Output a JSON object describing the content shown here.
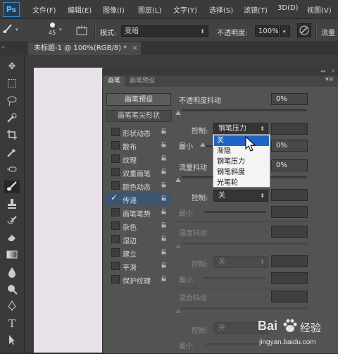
{
  "app": {
    "logo": "Ps"
  },
  "menu": [
    "文件(F)",
    "编辑(E)",
    "图像(I)",
    "图层(L)",
    "文字(Y)",
    "选择(S)",
    "滤镜(T)",
    "3D(D)",
    "视图(V)"
  ],
  "options_bar": {
    "brush_size": "45",
    "mode_label": "模式:",
    "mode_value": "变暗",
    "opacity_label": "不透明度:",
    "opacity_value": "100%",
    "flow_label": "流量"
  },
  "document_tab": {
    "title": "未标题-1 @ 100%(RGB/8) *",
    "close": "×"
  },
  "brush_panel": {
    "tabs": [
      "画笔",
      "画笔预设"
    ],
    "presets_button": "画笔预设",
    "tip_shape": "画笔笔尖形状",
    "options": [
      {
        "label": "形状动态",
        "checked": false,
        "selected": false
      },
      {
        "label": "散布",
        "checked": false,
        "selected": false
      },
      {
        "label": "纹理",
        "checked": false,
        "selected": false
      },
      {
        "label": "双重画笔",
        "checked": false,
        "selected": false
      },
      {
        "label": "颜色动态",
        "checked": false,
        "selected": false
      },
      {
        "label": "传递",
        "checked": true,
        "selected": true
      },
      {
        "label": "画笔笔势",
        "checked": false,
        "selected": false
      },
      {
        "label": "杂色",
        "checked": false,
        "selected": false
      },
      {
        "label": "湿边",
        "checked": false,
        "selected": false
      },
      {
        "label": "建立",
        "checked": false,
        "selected": false
      },
      {
        "label": "平滑",
        "checked": false,
        "selected": false
      },
      {
        "label": "保护纹理",
        "checked": false,
        "selected": false
      }
    ],
    "opacity_jitter": {
      "label": "不透明度抖动",
      "value": "0%"
    },
    "control_label": "控制:",
    "control_value_1": "钢笔压力",
    "min_label": "最小",
    "min_value_1": "0%",
    "flow_jitter": {
      "label": "流量抖动",
      "value": "0%"
    },
    "control_value_2": "关",
    "wetness_jitter": "湿度抖动",
    "mix_jitter": "混合抖动",
    "dropdown_options": [
      "关",
      "渐隐",
      "钢笔压力",
      "钢笔斜度",
      "光笔轮"
    ]
  },
  "watermark": {
    "brand": "Bai",
    "brand2": "经验",
    "url": "jingyan.baidu.com"
  }
}
